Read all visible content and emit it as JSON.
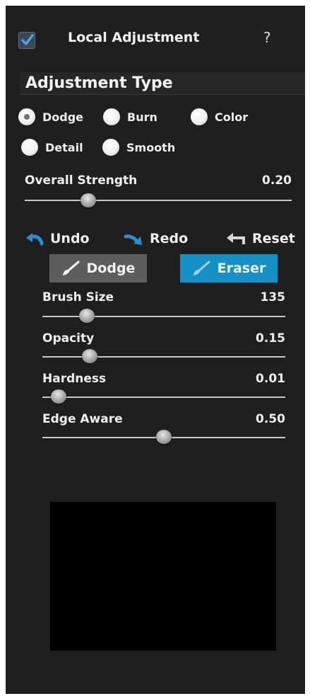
{
  "header": {
    "title": "Local Adjustment",
    "help": "?",
    "enabled": true
  },
  "adjustment_type": {
    "title": "Adjustment Type",
    "options": [
      "Dodge",
      "Burn",
      "Color",
      "Detail",
      "Smooth"
    ],
    "selected": "Dodge"
  },
  "overall_strength": {
    "label": "Overall Strength",
    "value": "0.20",
    "level": 0.22
  },
  "actions": {
    "undo": "Undo",
    "redo": "Redo",
    "reset": "Reset"
  },
  "mode": {
    "dodge": "Dodge",
    "eraser": "Eraser",
    "active": "Eraser"
  },
  "brush": {
    "size": {
      "label": "Brush Size",
      "value": "135",
      "level": 0.18
    },
    "opacity": {
      "label": "Opacity",
      "value": "0.15",
      "level": 0.19
    },
    "hardness": {
      "label": "Hardness",
      "value": "0.01",
      "level": 0.07
    },
    "edge_aware": {
      "label": "Edge Aware",
      "value": "0.50",
      "level": 0.5
    }
  },
  "colors": {
    "panel_bg": "#1f1f1f",
    "accent": "#1591c8",
    "text": "#efefef"
  }
}
